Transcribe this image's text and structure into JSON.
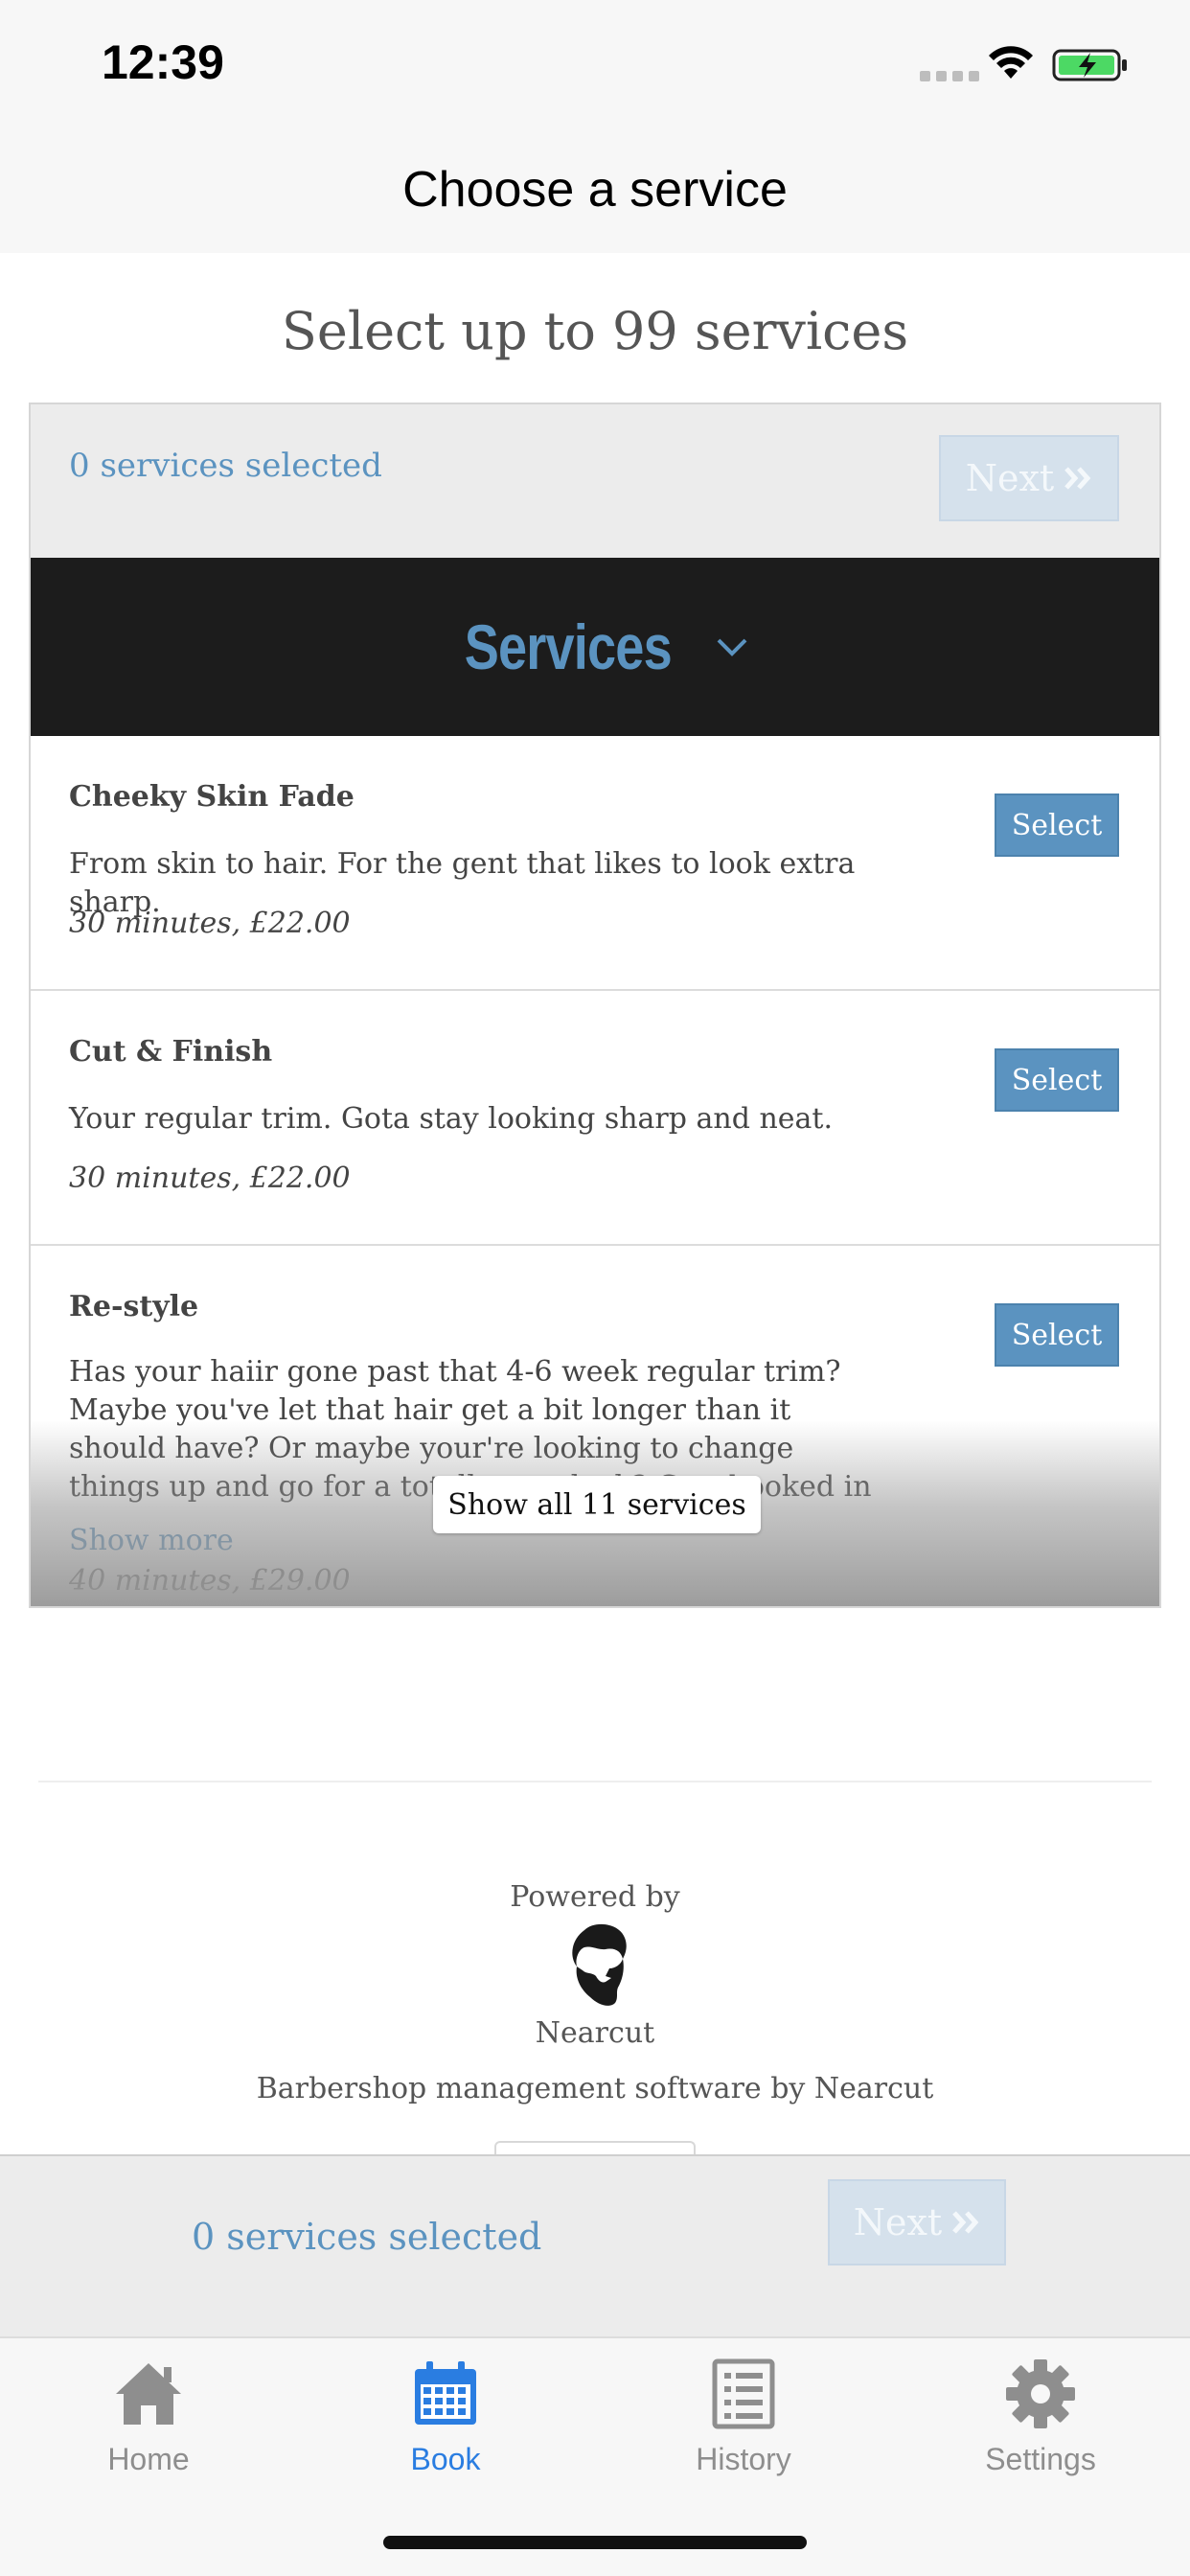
{
  "status": {
    "time": "12:39"
  },
  "nav": {
    "title": "Choose a service"
  },
  "page": {
    "heading": "Select up to 99 services"
  },
  "selection": {
    "count_text": "0 services selected",
    "next_label": "Next"
  },
  "category": {
    "label": "Services"
  },
  "services": [
    {
      "name": "Cheeky Skin Fade",
      "description": "From skin to hair. For the gent that likes to look extra sharp.",
      "meta": "30 minutes, £22.00",
      "button": "Select"
    },
    {
      "name": "Cut & Finish",
      "description": "Your regular trim. Gota stay looking sharp and neat.",
      "meta": "30 minutes, £22.00",
      "button": "Select"
    },
    {
      "name": "Re-style",
      "description": "Has your haiir gone past that 4-6 week regular trim? Maybe you've let that hair get a bit longer than it should have? Or maybe your're looking to change things up and go for a totally new look? Gett booked in for a restyle and we can",
      "meta": "40 minutes, £29.00",
      "button": "Select",
      "show_more": "Show more"
    }
  ],
  "show_all_label": "Show all 11 services",
  "footer": {
    "powered_by": "Powered by",
    "brand": "Nearcut",
    "tagline": "Barbershop management software by Nearcut"
  },
  "sticky": {
    "count_text": "0 services selected",
    "next_label": "Next"
  },
  "tabs": [
    {
      "label": "Home",
      "icon": "home-icon"
    },
    {
      "label": "Book",
      "icon": "calendar-icon"
    },
    {
      "label": "History",
      "icon": "list-icon"
    },
    {
      "label": "Settings",
      "icon": "gear-icon"
    }
  ],
  "colors": {
    "accent": "#5b93c0",
    "tab_active": "#2a7de1",
    "tab_inactive": "#8e8e8e",
    "header_dark": "#1c1c1c"
  }
}
